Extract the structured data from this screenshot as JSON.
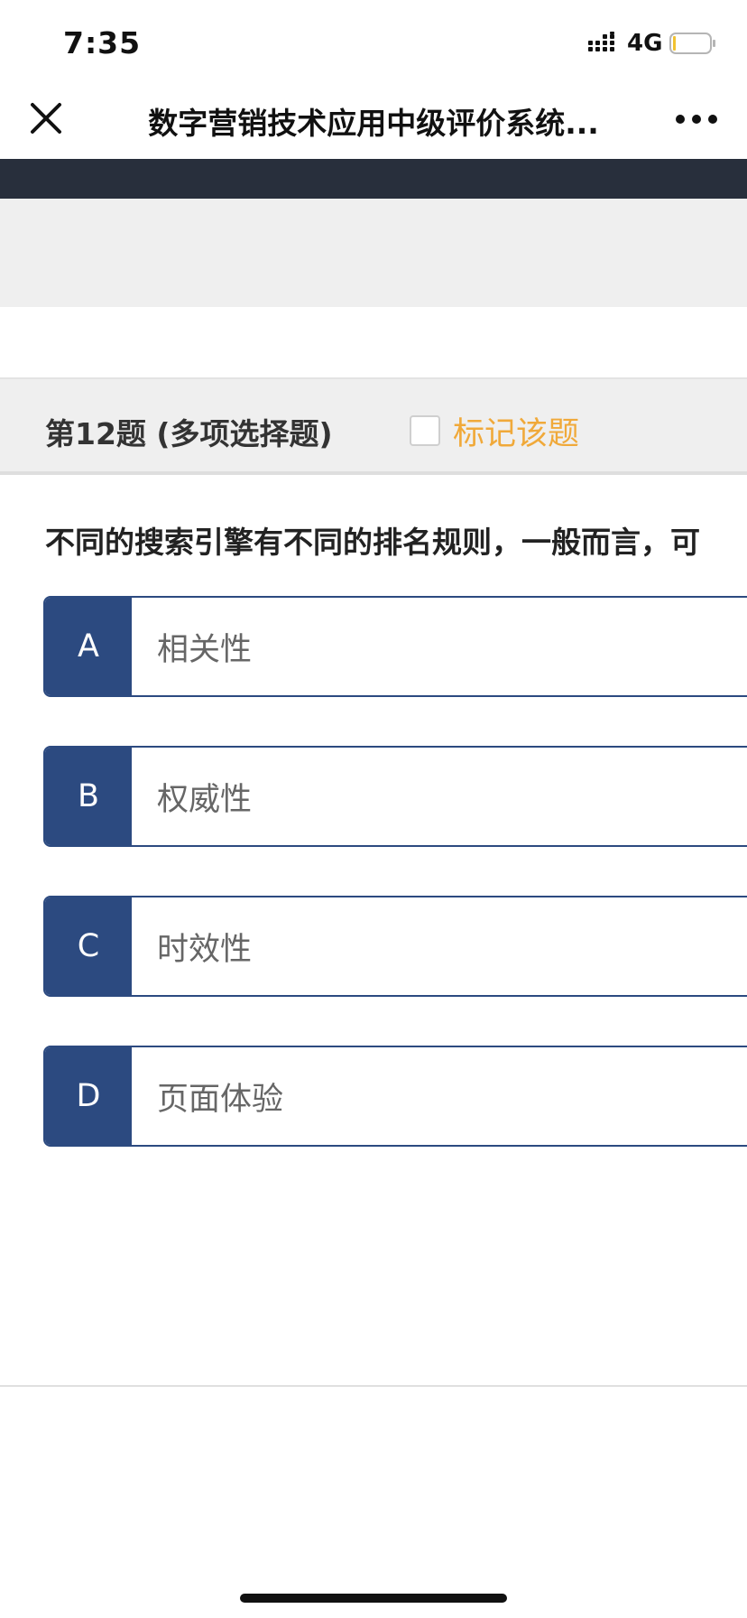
{
  "status_bar": {
    "time": "7:35",
    "network": "4G"
  },
  "nav": {
    "title": "数字营销技术应用中级评价系统..."
  },
  "question": {
    "number_label": "第12题 (多项选择题)",
    "mark_label": "标记该题",
    "text": "不同的搜索引擎有不同的排名规则，一般而言，可",
    "options": [
      {
        "letter": "A",
        "text": "相关性"
      },
      {
        "letter": "B",
        "text": "权威性"
      },
      {
        "letter": "C",
        "text": "时效性"
      },
      {
        "letter": "D",
        "text": "页面体验"
      }
    ]
  },
  "colors": {
    "accent": "#2c4a80",
    "mark_label": "#f0a93a",
    "dark_band": "#282f3c"
  },
  "icons": {
    "close": "close-icon",
    "more": "more-icon",
    "signal": "signal-icon",
    "battery": "battery-icon"
  }
}
